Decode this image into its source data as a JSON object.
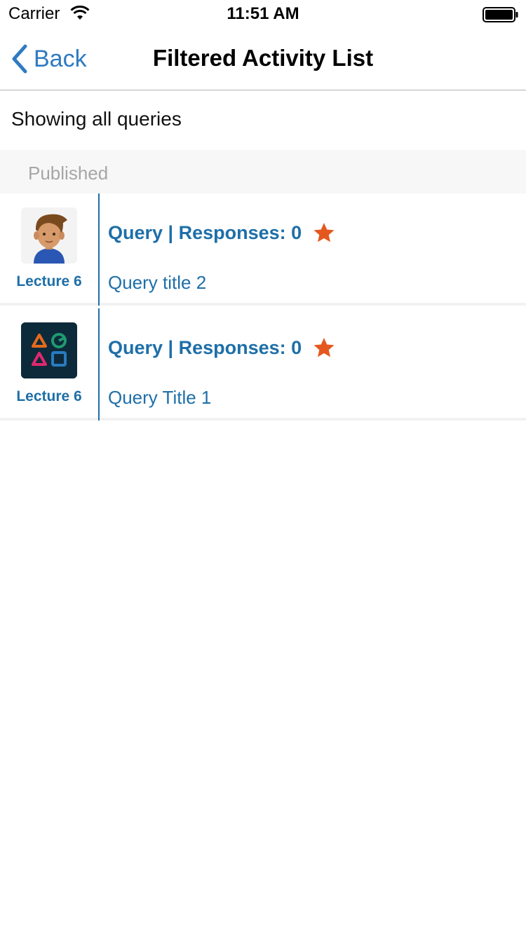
{
  "status_bar": {
    "carrier": "Carrier",
    "time": "11:51 AM"
  },
  "nav": {
    "back_label": "Back",
    "title": "Filtered Activity List"
  },
  "filter_text": "Showing all queries",
  "section": {
    "label": "Published"
  },
  "rows": [
    {
      "avatar": "boy-avatar-icon",
      "lecture": "Lecture 6",
      "title": "Query | Responses: 0",
      "subtitle": "Query title 2",
      "starred": true
    },
    {
      "avatar": "shapes-logo-icon",
      "lecture": "Lecture 6",
      "title": "Query | Responses: 0",
      "subtitle": "Query Title 1",
      "starred": true
    }
  ],
  "colors": {
    "accent": "#1e6fa8",
    "back": "#2f7bc1",
    "star": "#e4581f",
    "section_bg": "#f7f7f7"
  }
}
